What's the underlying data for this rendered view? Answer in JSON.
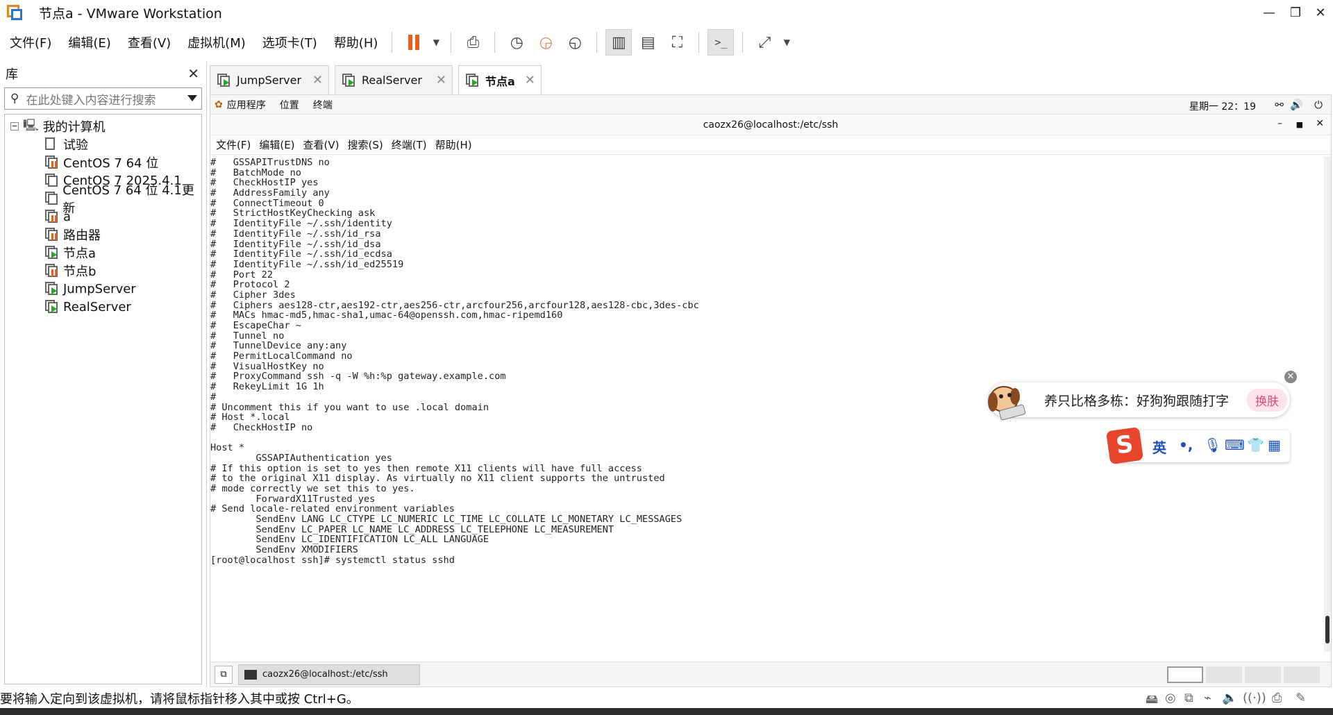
{
  "window": {
    "title": "节点a - VMware Workstation",
    "minimize": "—",
    "maximize": "❐",
    "close": "✕"
  },
  "menu": [
    "文件(F)",
    "编辑(E)",
    "查看(V)",
    "虚拟机(M)",
    "选项卡(T)",
    "帮助(H)"
  ],
  "library": {
    "title": "库",
    "close": "✕",
    "search_placeholder": "在此处键入内容进行搜索",
    "root": "我的计算机",
    "items": [
      {
        "label": "试验",
        "state": "off"
      },
      {
        "label": "CentOS 7 64 位",
        "state": "paused"
      },
      {
        "label": "CentOS 7 2025.4.1",
        "state": "off"
      },
      {
        "label": "CentOS 7 64 位 4.1更新",
        "state": "off"
      },
      {
        "label": "a",
        "state": "paused"
      },
      {
        "label": "路由器",
        "state": "paused"
      },
      {
        "label": "节点a",
        "state": "running"
      },
      {
        "label": "节点b",
        "state": "paused"
      },
      {
        "label": "JumpServer",
        "state": "running"
      },
      {
        "label": "RealServer",
        "state": "running"
      }
    ]
  },
  "tabs": [
    {
      "label": "JumpServer",
      "active": false
    },
    {
      "label": "RealServer",
      "active": false
    },
    {
      "label": "节点a",
      "active": true
    }
  ],
  "gnome": {
    "apps": "应用程序",
    "places": "位置",
    "terminal": "终端",
    "clock": "星期一 22：19"
  },
  "terminal_window": {
    "title": "caozx26@localhost:/etc/ssh",
    "menu": [
      "文件(F)",
      "编辑(E)",
      "查看(V)",
      "搜索(S)",
      "终端(T)",
      "帮助(H)"
    ],
    "lines": [
      "#   GSSAPITrustDNS no",
      "#   BatchMode no",
      "#   CheckHostIP yes",
      "#   AddressFamily any",
      "#   ConnectTimeout 0",
      "#   StrictHostKeyChecking ask",
      "#   IdentityFile ~/.ssh/identity",
      "#   IdentityFile ~/.ssh/id_rsa",
      "#   IdentityFile ~/.ssh/id_dsa",
      "#   IdentityFile ~/.ssh/id_ecdsa",
      "#   IdentityFile ~/.ssh/id_ed25519",
      "#   Port 22",
      "#   Protocol 2",
      "#   Cipher 3des",
      "#   Ciphers aes128-ctr,aes192-ctr,aes256-ctr,arcfour256,arcfour128,aes128-cbc,3des-cbc",
      "#   MACs hmac-md5,hmac-sha1,umac-64@openssh.com,hmac-ripemd160",
      "#   EscapeChar ~",
      "#   Tunnel no",
      "#   TunnelDevice any:any",
      "#   PermitLocalCommand no",
      "#   VisualHostKey no",
      "#   ProxyCommand ssh -q -W %h:%p gateway.example.com",
      "#   RekeyLimit 1G 1h",
      "#",
      "# Uncomment this if you want to use .local domain",
      "# Host *.local",
      "#   CheckHostIP no",
      "",
      "Host *",
      "\tGSSAPIAuthentication yes",
      "# If this option is set to yes then remote X11 clients will have full access",
      "# to the original X11 display. As virtually no X11 client supports the untrusted",
      "# mode correctly we set this to yes.",
      "\tForwardX11Trusted yes",
      "# Send locale-related environment variables",
      "\tSendEnv LANG LC_CTYPE LC_NUMERIC LC_TIME LC_COLLATE LC_MONETARY LC_MESSAGES",
      "\tSendEnv LC_PAPER LC_NAME LC_ADDRESS LC_TELEPHONE LC_MEASUREMENT",
      "\tSendEnv LC_IDENTIFICATION LC_ALL LANGUAGE",
      "\tSendEnv XMODIFIERS",
      "[root@localhost ssh]# systemctl status sshd"
    ]
  },
  "taskbar": {
    "window_label": "caozx26@localhost:/etc/ssh"
  },
  "ime": {
    "tip": "养只比格多栋：好狗狗跟随打字",
    "swap": "换肤",
    "close": "✕",
    "lang": "英",
    "punct": "•,",
    "logo": "S"
  },
  "status": {
    "message": "要将输入定向到该虚拟机，请将鼠标指针移入其中或按 Ctrl+G。"
  },
  "icons": [
    "search-icon",
    "computer-icon",
    "vm-icon",
    "pause-icon",
    "snapshot-icon",
    "console-icon",
    "fullscreen-icon",
    "microphone-icon",
    "keyboard-icon",
    "speaker-icon",
    "power-icon",
    "network-icon"
  ]
}
